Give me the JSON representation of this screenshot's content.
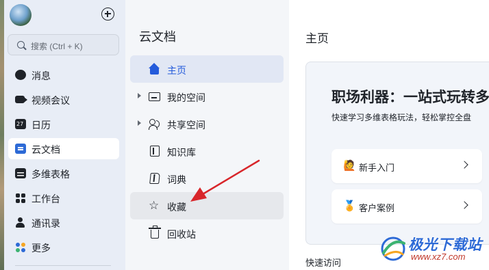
{
  "sidebar": {
    "search_placeholder": "搜索 (Ctrl + K)",
    "items": [
      {
        "label": "消息",
        "icon": "message-icon"
      },
      {
        "label": "视频会议",
        "icon": "video-icon"
      },
      {
        "label": "日历",
        "icon": "calendar-icon"
      },
      {
        "label": "云文档",
        "icon": "cloud-doc-icon",
        "active": true
      },
      {
        "label": "多维表格",
        "icon": "table-icon"
      },
      {
        "label": "工作台",
        "icon": "workplace-icon"
      },
      {
        "label": "通讯录",
        "icon": "contacts-icon"
      },
      {
        "label": "更多",
        "icon": "more-icon"
      }
    ]
  },
  "docs_panel": {
    "title": "云文档",
    "items": [
      {
        "label": "主页",
        "icon": "home-icon",
        "selected": true
      },
      {
        "label": "我的空间",
        "icon": "folder-icon",
        "expandable": true
      },
      {
        "label": "共享空间",
        "icon": "people-icon",
        "expandable": true
      },
      {
        "label": "知识库",
        "icon": "book-icon"
      },
      {
        "label": "词典",
        "icon": "dictionary-icon"
      },
      {
        "label": "收藏",
        "icon": "star-icon"
      },
      {
        "label": "回收站",
        "icon": "trash-icon"
      }
    ]
  },
  "main": {
    "title": "主页",
    "banner": {
      "headline": "职场利器：一站式玩转多",
      "subtitle": "快速学习多维表格玩法，轻松掌控全盘",
      "cards": [
        {
          "emoji": "🙋",
          "label": "新手入门"
        },
        {
          "emoji": "🏅",
          "label": "客户案例"
        }
      ]
    },
    "quick_access": "快速访问"
  },
  "watermark": {
    "text": "极光下载站",
    "url": "www.xz7.com"
  },
  "colors": {
    "accent": "#245bdb",
    "annotation_arrow": "#d8262b"
  }
}
